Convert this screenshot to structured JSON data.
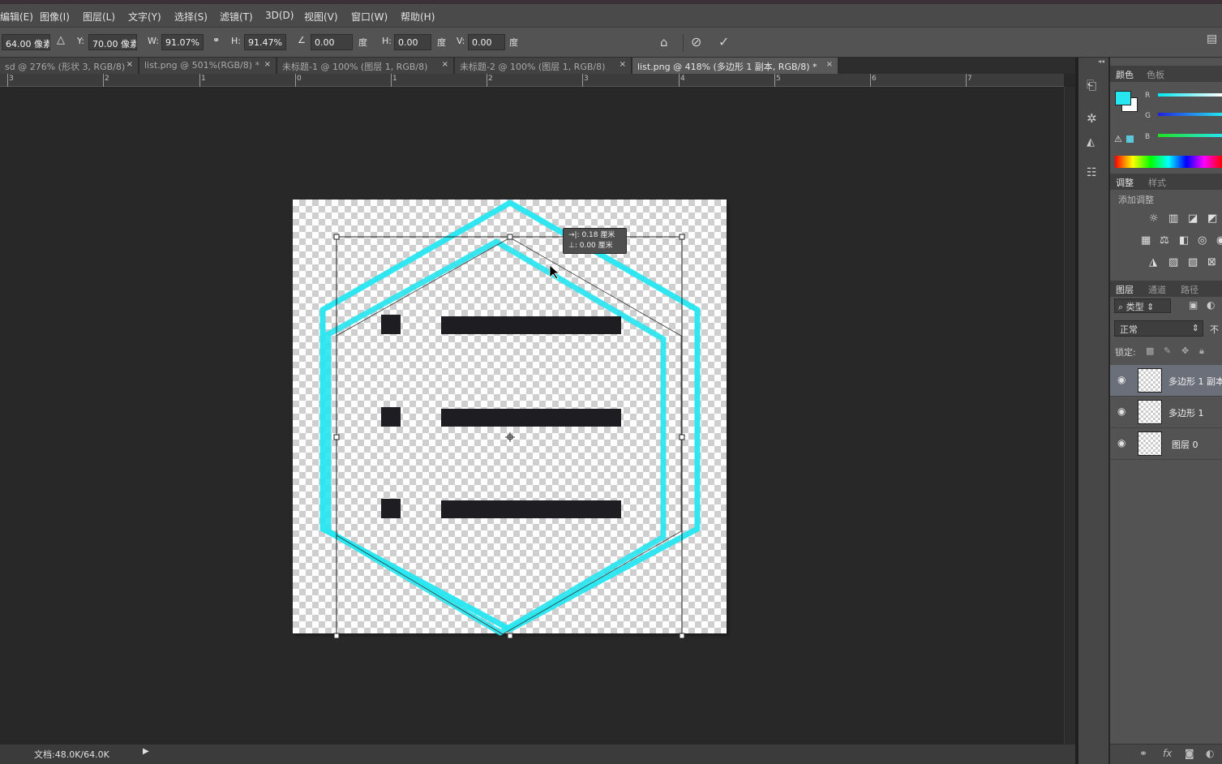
{
  "menu": [
    "编辑(E)",
    "图像(I)",
    "图层(L)",
    "文字(Y)",
    "选择(S)",
    "滤镜(T)",
    "3D(D)",
    "视图(V)",
    "窗口(W)",
    "帮助(H)"
  ],
  "options": {
    "x_value": "64.00 像素",
    "y_label": "Y:",
    "y_value": "70.00 像素",
    "w_label": "W:",
    "w_value": "91.07%",
    "h_label": "H:",
    "h_value": "91.47%",
    "angle_value": "0.00",
    "angle_unit": "度",
    "hskew_label": "H:",
    "hskew_value": "0.00",
    "hskew_unit": "度",
    "vskew_label": "V:",
    "vskew_value": "0.00",
    "vskew_unit": "度"
  },
  "tabs": [
    {
      "label": "sd @ 276% (形状 3, RGB/8)",
      "close": "×"
    },
    {
      "label": "list.png @ 501%(RGB/8) *",
      "close": "×"
    },
    {
      "label": "未标题-1 @ 100% (图层 1, RGB/8)",
      "close": "×"
    },
    {
      "label": "未标题-2 @ 100% (图层 1, RGB/8)",
      "close": "×"
    },
    {
      "label": "list.png @ 418% (多边形 1 副本, RGB/8) *",
      "close": "×"
    }
  ],
  "ruler_numbers": [
    "3",
    "2",
    "1",
    "0",
    "1",
    "2",
    "3",
    "4",
    "5",
    "6",
    "7"
  ],
  "tooltip": {
    "line1": "0.18 厘米",
    "line2": "0.00 厘米"
  },
  "status": {
    "doc": "文档:48.0K/64.0K"
  },
  "panels": {
    "color_tab": "颜色",
    "swatches_tab": "色板",
    "r": "R",
    "g": "G",
    "b": "B",
    "adjust_tab": "调整",
    "styles_tab": "样式",
    "add_adjust": "添加调整",
    "layers_tab": "图层",
    "channels_tab": "通道",
    "paths_tab": "路径",
    "kind": "类型",
    "blend": "正常",
    "opacity_partial": "不",
    "lock": "锁定:",
    "layers": [
      "多边形 1 副本",
      "多边形 1",
      "图层 0"
    ]
  },
  "colors": {
    "accent": "#26e6f0",
    "foreground": "#26e6f0",
    "background": "#ffffff"
  }
}
